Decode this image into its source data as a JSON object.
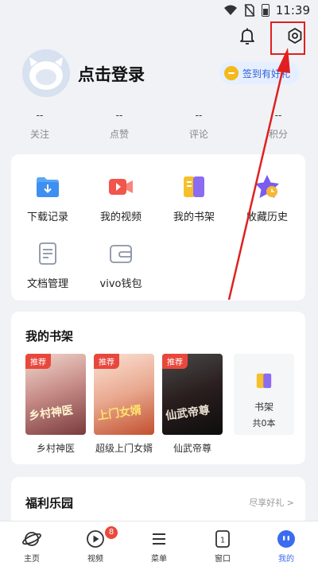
{
  "status_bar": {
    "time": "11:39"
  },
  "header": {
    "bell_icon": "bell-icon",
    "settings_icon": "settings-icon",
    "settings_highlight_color": "#e02020"
  },
  "profile": {
    "login_text": "点击登录",
    "sign_button_label": "签到有好礼"
  },
  "stats": [
    {
      "value": "--",
      "label": "关注"
    },
    {
      "value": "--",
      "label": "点赞"
    },
    {
      "value": "--",
      "label": "评论"
    },
    {
      "value": "--",
      "label": "积分"
    }
  ],
  "tools": [
    {
      "label": "下载记录",
      "icon": "download-folder-icon"
    },
    {
      "label": "我的视频",
      "icon": "video-icon"
    },
    {
      "label": "我的书架",
      "icon": "bookshelf-icon"
    },
    {
      "label": "收藏历史",
      "icon": "star-clock-icon"
    },
    {
      "label": "文档管理",
      "icon": "document-icon"
    },
    {
      "label": "vivo钱包",
      "icon": "wallet-icon"
    }
  ],
  "shelf": {
    "title": "我的书架",
    "badge": "推荐",
    "books": [
      {
        "title": "乡村神医",
        "cover_text": "乡村神医"
      },
      {
        "title": "超级上门女婿",
        "cover_text": "上门女婿"
      },
      {
        "title": "仙武帝尊",
        "cover_text": "仙武帝尊"
      }
    ],
    "tile_label": "书架",
    "tile_count": "共0本"
  },
  "welfare": {
    "title": "福利乐园",
    "more": "尽享好礼 >"
  },
  "tabbar": {
    "items": [
      {
        "label": "主页",
        "icon": "planet-icon"
      },
      {
        "label": "视频",
        "icon": "play-icon"
      },
      {
        "label": "菜单",
        "icon": "menu-icon"
      },
      {
        "label": "窗口",
        "icon": "window-icon"
      },
      {
        "label": "我的",
        "icon": "profile-face-icon"
      }
    ],
    "video_badge": "8",
    "active_index": 4
  },
  "colors": {
    "accent": "#3a6bf0",
    "badge_red": "#e94a3b",
    "coin": "#f4b91b"
  }
}
